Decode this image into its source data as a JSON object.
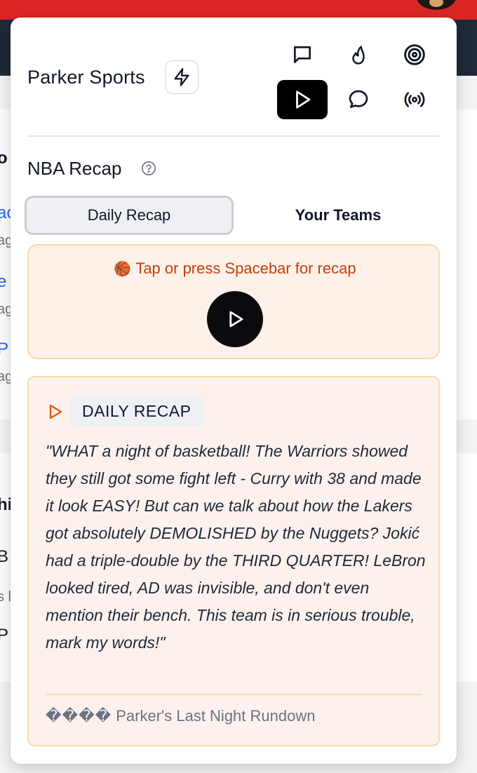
{
  "background": {
    "left_fragments": [
      {
        "text": "o",
        "style": "bold"
      },
      {
        "text": "ac",
        "style": "blue"
      },
      {
        "text": "ag",
        "style": "gray"
      },
      {
        "text": "e",
        "style": "blue"
      },
      {
        "text": "ag",
        "style": "gray"
      },
      {
        "text": "P",
        "style": "blue"
      },
      {
        "text": "ag",
        "style": "gray"
      },
      {
        "text": "hi",
        "style": "bold"
      },
      {
        "text": "B",
        "style": "dark"
      },
      {
        "text": "s l",
        "style": "gray"
      },
      {
        "text": "P",
        "style": "dark"
      }
    ]
  },
  "header": {
    "brand": "Parker Sports",
    "bolt_icon": "lightning-bolt-icon",
    "icons": [
      "chat-square-icon",
      "flame-icon",
      "target-icon",
      "play-icon",
      "chat-bubble-icon",
      "broadcast-icon"
    ],
    "active_icon": "play-icon"
  },
  "section": {
    "title": "NBA Recap",
    "help_icon": "question-circle-icon"
  },
  "tabs": {
    "items": [
      "Daily Recap",
      "Your Teams"
    ],
    "active": "Daily Recap"
  },
  "tap_card": {
    "emoji": "🏀",
    "text": "Tap or press Spacebar for recap"
  },
  "recap": {
    "badge": "DAILY RECAP",
    "quote": "\"WHAT a night of basketball! The Warriors showed they still got some fight left - Curry with 38 and made it look EASY! But can we talk about how the Lakers got absolutely DEMOLISHED by the Nuggets? Jokić had a triple-double by the THIRD QUARTER! LeBron looked tired, AD was invisible, and don't even mention their bench. This team is in serious trouble, mark my words!\"",
    "byline_glyphs": "����",
    "byline": "Parker's Last Night Rundown"
  },
  "colors": {
    "brand_red": "#dc2626",
    "accent_orange": "#c2410c",
    "card_border": "#fcd9a8",
    "card_bg": "#fdf1ea"
  }
}
